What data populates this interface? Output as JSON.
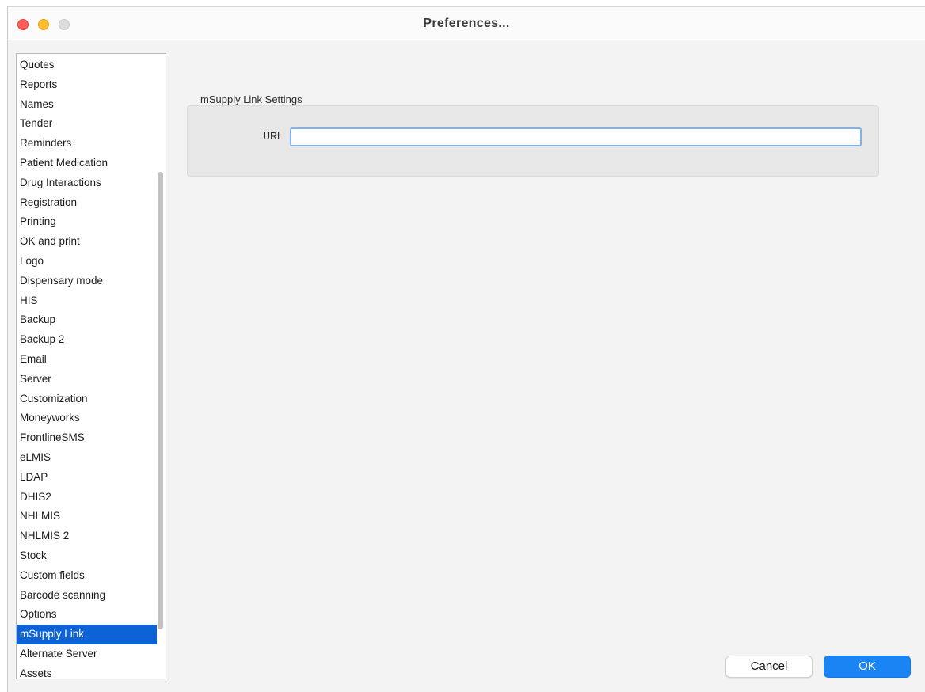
{
  "window": {
    "title": "Preferences..."
  },
  "sidebar": {
    "selected_index": 29,
    "items": [
      {
        "label": "Quotes"
      },
      {
        "label": "Reports"
      },
      {
        "label": "Names"
      },
      {
        "label": "Tender"
      },
      {
        "label": "Reminders"
      },
      {
        "label": "Patient Medication"
      },
      {
        "label": "Drug Interactions"
      },
      {
        "label": "Registration"
      },
      {
        "label": "Printing"
      },
      {
        "label": "OK and print"
      },
      {
        "label": "Logo"
      },
      {
        "label": "Dispensary mode"
      },
      {
        "label": "HIS"
      },
      {
        "label": "Backup"
      },
      {
        "label": "Backup 2"
      },
      {
        "label": "Email"
      },
      {
        "label": "Server"
      },
      {
        "label": "Customization"
      },
      {
        "label": "Moneyworks"
      },
      {
        "label": "FrontlineSMS"
      },
      {
        "label": "eLMIS"
      },
      {
        "label": "LDAP"
      },
      {
        "label": "DHIS2"
      },
      {
        "label": "NHLMIS"
      },
      {
        "label": "NHLMIS 2"
      },
      {
        "label": "Stock"
      },
      {
        "label": "Custom fields"
      },
      {
        "label": "Barcode scanning"
      },
      {
        "label": "Options"
      },
      {
        "label": "mSupply Link"
      },
      {
        "label": "Alternate Server"
      },
      {
        "label": "Assets"
      }
    ]
  },
  "main": {
    "section_title": "mSupply Link Settings",
    "url_label": "URL",
    "url_value": ""
  },
  "buttons": {
    "cancel_label": "Cancel",
    "ok_label": "OK"
  },
  "colors": {
    "selection": "#0d63d6",
    "ok_button": "#1a84f5",
    "focus_ring": "#7fb1f2"
  }
}
